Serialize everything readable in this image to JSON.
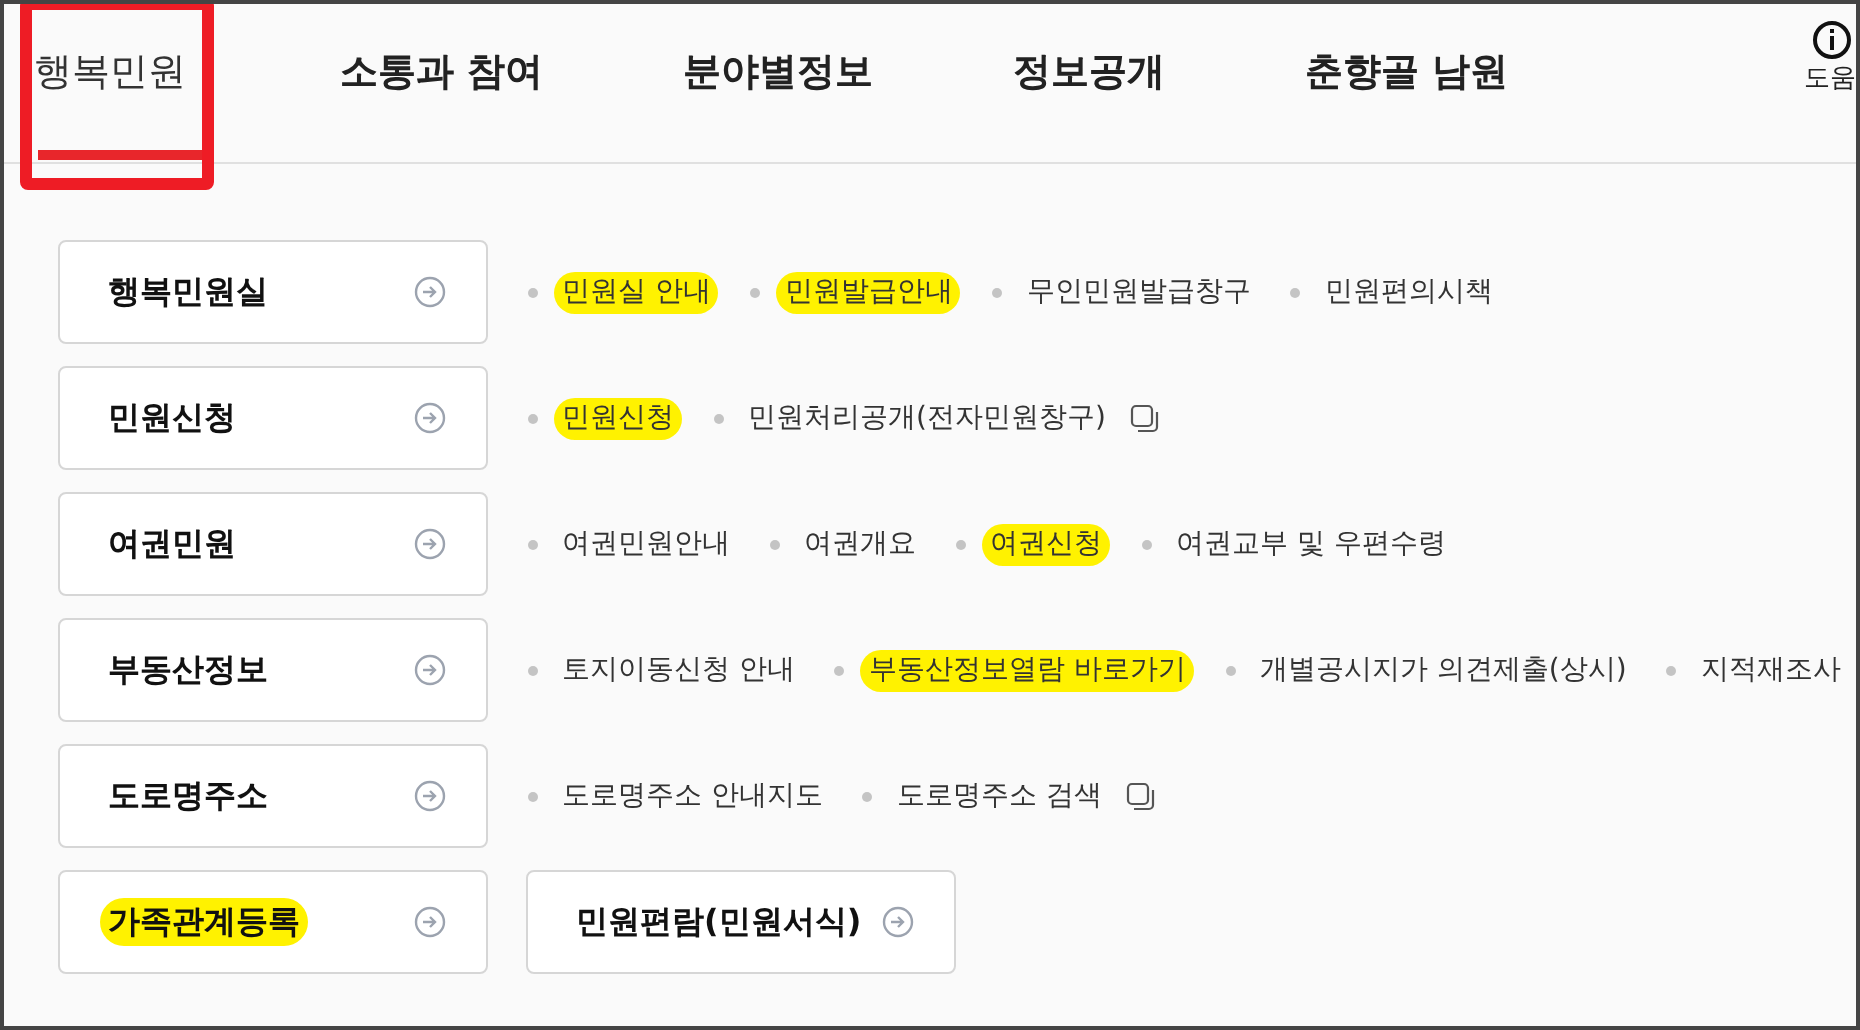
{
  "nav": {
    "tabs": [
      {
        "label": "행복민원",
        "selected": true,
        "marked": true
      },
      {
        "label": "소통과 참여",
        "selected": false,
        "marked": false
      },
      {
        "label": "분야별정보",
        "selected": false,
        "marked": false
      },
      {
        "label": "정보공개",
        "selected": false,
        "marked": false
      },
      {
        "label": "춘향골 남원",
        "selected": false,
        "marked": false
      }
    ],
    "help": {
      "label": "도움"
    }
  },
  "rows": [
    {
      "kind": "links",
      "title": "행복민원실",
      "highlighted": false,
      "links": [
        {
          "label": "민원실 안내",
          "highlighted": true,
          "external": false
        },
        {
          "label": "민원발급안내",
          "highlighted": true,
          "external": false
        },
        {
          "label": "무인민원발급창구",
          "highlighted": false,
          "external": false
        },
        {
          "label": "민원편의시책",
          "highlighted": false,
          "external": false
        }
      ]
    },
    {
      "kind": "links",
      "title": "민원신청",
      "highlighted": false,
      "links": [
        {
          "label": "민원신청",
          "highlighted": true,
          "external": false
        },
        {
          "label": "민원처리공개(전자민원창구)",
          "highlighted": false,
          "external": true
        }
      ]
    },
    {
      "kind": "links",
      "title": "여권민원",
      "highlighted": false,
      "links": [
        {
          "label": "여권민원안내",
          "highlighted": false,
          "external": false
        },
        {
          "label": "여권개요",
          "highlighted": false,
          "external": false
        },
        {
          "label": "여권신청",
          "highlighted": true,
          "external": false
        },
        {
          "label": "여권교부 및 우편수령",
          "highlighted": false,
          "external": false
        }
      ]
    },
    {
      "kind": "links",
      "title": "부동산정보",
      "highlighted": false,
      "links": [
        {
          "label": "토지이동신청 안내",
          "highlighted": false,
          "external": false
        },
        {
          "label": "부동산정보열람 바로가기",
          "highlighted": true,
          "external": false
        },
        {
          "label": "개별공시지가 의견제출(상시)",
          "highlighted": false,
          "external": false
        },
        {
          "label": "지적재조사",
          "highlighted": false,
          "external": false
        }
      ]
    },
    {
      "kind": "links",
      "title": "도로명주소",
      "highlighted": false,
      "links": [
        {
          "label": "도로명주소 안내지도",
          "highlighted": false,
          "external": false
        },
        {
          "label": "도로명주소 검색",
          "highlighted": false,
          "external": true
        }
      ]
    },
    {
      "kind": "boxes",
      "boxes": [
        {
          "title": "가족관계등록",
          "highlighted": true
        },
        {
          "title": "민원편람(민원서식)",
          "highlighted": false
        }
      ]
    }
  ]
}
